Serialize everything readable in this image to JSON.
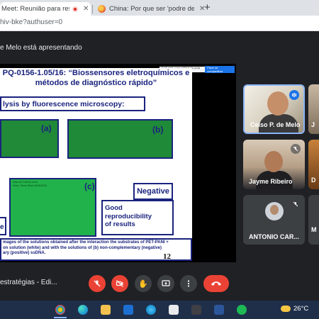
{
  "browser": {
    "tabs": [
      {
        "title": "Meet: Reunião para resultad",
        "active": true
      },
      {
        "title": "China: Por que ser 'podre de ric",
        "active": false
      }
    ],
    "new_tab_symbol": "+",
    "url": "hiv-bke?authuser=0"
  },
  "meet": {
    "presenting_text": "e Melo está apresentando",
    "meeting_name": "estratégias - Edi..."
  },
  "slide_toolbar": {
    "info": "Você está compartilhando uma tela",
    "stop_label": "Parar de compartilhar"
  },
  "slide": {
    "title_line1": "PQ-0156-1.05/16: “Biossensores eletroquímicos e",
    "title_line2": "métodos de diagnóstico rápido”",
    "analysis_label": "lysis by fluorescence microscopy:",
    "panel_a_label": "(a)",
    "panel_b_label": "(b)",
    "panel_c_label": "(c)",
    "panel_c_note1": "Data 2017/06/20 16:xx",
    "panel_c_note2": "Veloz, Green 80ms 30/04/2010",
    "negative_label": "Negative",
    "good_line1": "Good",
    "good_line2": "reproducibility",
    "good_line3": "of results",
    "e_label": "e",
    "caption_line1": "mages of the solutions obtained after the interaction the substrates of PET-PANI +",
    "caption_line2": "on solution (white) and with the solutions of (b) non-complementary (negative)",
    "caption_line3": "ary (positive) ssDNA.",
    "page_number": "12"
  },
  "participants": [
    {
      "name": "Celso P. de Melo",
      "peek": "J",
      "mic": "active"
    },
    {
      "name": "Jayme Ribeiro",
      "peek": "D",
      "mic": "muted"
    },
    {
      "name": "ANTONIO CAR...",
      "peek": "M",
      "mic": "muted"
    }
  ],
  "taskbar": {
    "temperature": "26°C"
  },
  "colors": {
    "meet_background": "#202124",
    "end_call_red": "#ea4335",
    "slide_blue": "#1a237e",
    "micro_green": "#1f8a37",
    "taskbar": "#1f2f4a"
  }
}
